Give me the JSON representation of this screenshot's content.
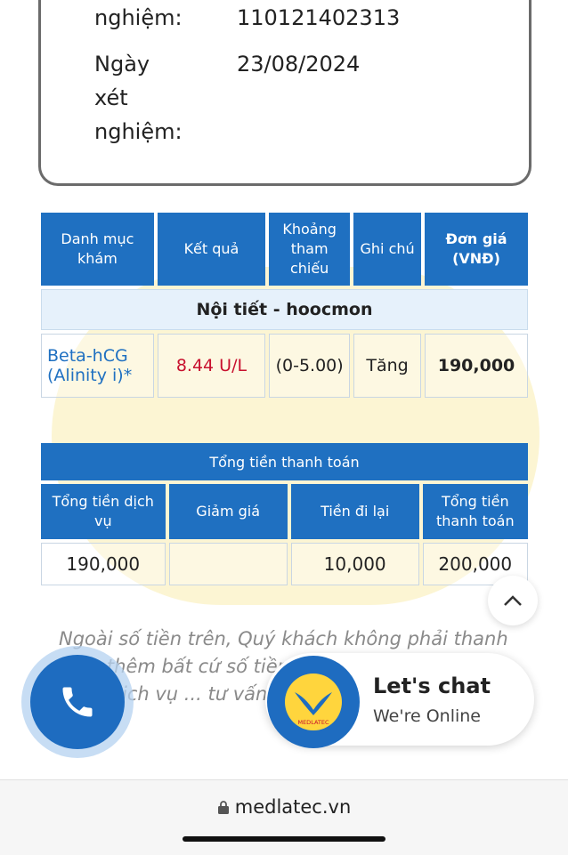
{
  "info": {
    "code_label_tail": "nghiệm:",
    "code_value": "110121402313",
    "date_label_1": "Ngày",
    "date_label_2": "xét",
    "date_label_3": "nghiệm:",
    "date_value": "23/08/2024"
  },
  "results_table": {
    "headers": [
      "Danh mục khám",
      "Kết quả",
      "Khoảng tham chiếu",
      "Ghi chú",
      "Đơn giá (VNĐ)"
    ],
    "group": "Nội tiết - hoocmon",
    "rows": [
      {
        "name": "Beta-hCG (Alinity i)*",
        "result": "8.44 U/L",
        "range": "(0-5.00)",
        "note": "Tăng",
        "price": "190,000"
      }
    ]
  },
  "totals_table": {
    "title": "Tổng tiền thanh toán",
    "headers": [
      "Tổng tiền dịch vụ",
      "Giảm giá",
      "Tiền đi lại",
      "Tổng tiền thanh toán"
    ],
    "values": [
      "190,000",
      "",
      "10,000",
      "200,000"
    ]
  },
  "notice": "Ngoài số tiền trên, Quý khách không phải thanh toán thêm bất cứ số tiền nào. Quý khách đã lựa chọn dịch vụ ... tư vấn kết quả xin ...",
  "chat": {
    "title": "Let's chat",
    "subtitle": "We're Online",
    "logo_text": "MEDLATEC"
  },
  "browser": {
    "url": "medlatec.vn"
  },
  "colors": {
    "primary": "#1f70c1",
    "result_red": "#c8102e"
  }
}
